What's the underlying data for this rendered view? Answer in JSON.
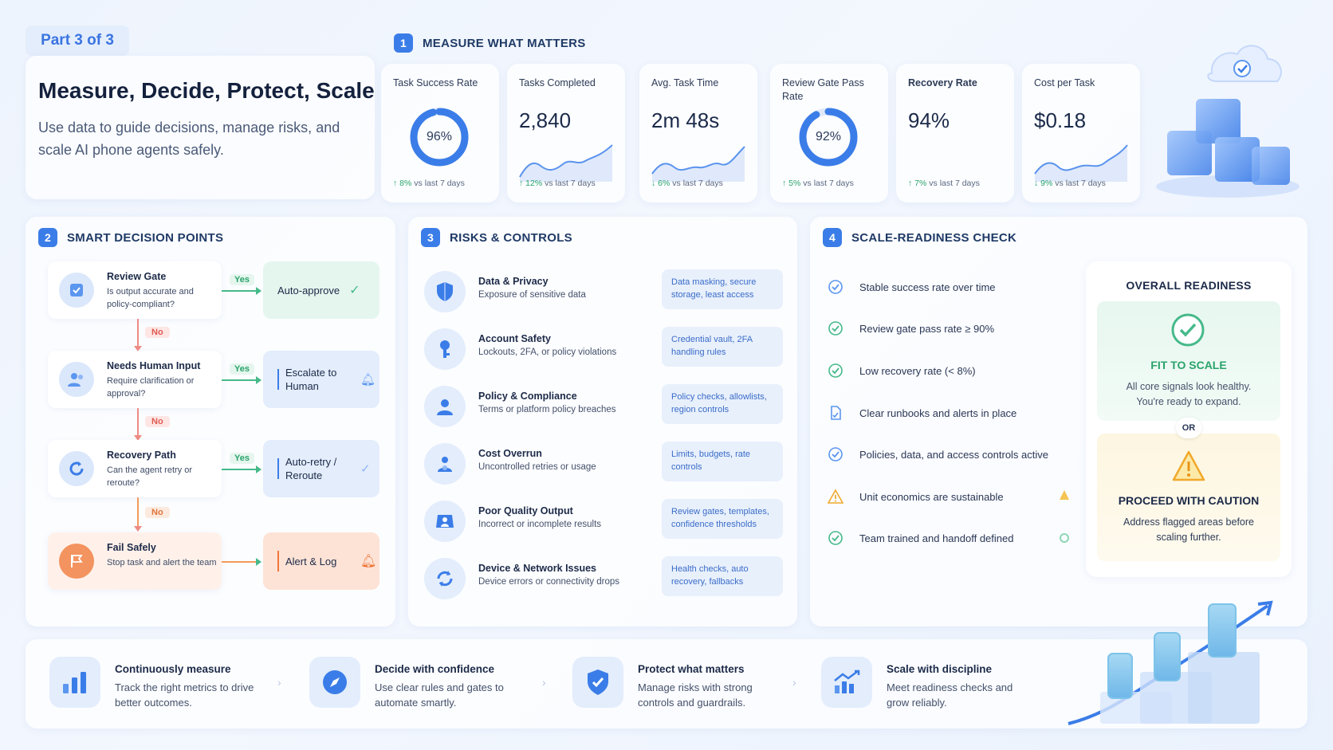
{
  "header": {
    "part": "Part 3 of 3",
    "title": "Measure, Decide, Protect, Scale",
    "subtitle": "Use data to guide decisions, manage risks, and scale AI phone agents safely."
  },
  "measure": {
    "num": "1",
    "title": "MEASURE WHAT MATTERS",
    "metrics": [
      {
        "label": "Task Success Rate",
        "value": "96%",
        "ring": 0.96,
        "arrow": "↑",
        "pct": "8%",
        "suffix": " vs last 7 days"
      },
      {
        "label": "Tasks Completed",
        "value": "2,840",
        "arrow": "↑",
        "pct": "12%",
        "suffix": " vs last 7 days"
      },
      {
        "label": "Avg. Task Time",
        "value": "2m 48s",
        "arrow": "↓",
        "pct": "6%",
        "suffix": " vs last 7 days"
      },
      {
        "label": "Review Gate Pass Rate",
        "value": "92%",
        "ring": 0.92,
        "arrow": "↑",
        "pct": "5%",
        "suffix": " vs last 7 days"
      },
      {
        "label": "Recovery Rate",
        "value": "94%",
        "arrow": "↑",
        "pct": "7%",
        "suffix": " vs last 7 days"
      },
      {
        "label": "Cost per Task",
        "value": "$0.18",
        "arrow": "↓",
        "pct": "9%",
        "suffix": " vs last 7 days"
      }
    ]
  },
  "decisions": {
    "num": "2",
    "title": "SMART DECISION POINTS",
    "yes": "Yes",
    "no": "No",
    "steps": [
      {
        "title": "Review Gate",
        "desc": "Is output accurate and policy-compliant?",
        "outcome": "Auto-approve"
      },
      {
        "title": "Needs Human Input",
        "desc": "Require clarification or approval?",
        "outcome": "Escalate to Human"
      },
      {
        "title": "Recovery Path",
        "desc": "Can the agent retry or reroute?",
        "outcome": "Auto-retry / Reroute"
      },
      {
        "title": "Fail Safely",
        "desc": "Stop task and alert the team",
        "outcome": "Alert & Log"
      }
    ]
  },
  "risks": {
    "num": "3",
    "title": "RISKS & CONTROLS",
    "items": [
      {
        "title": "Data & Privacy",
        "desc": "Exposure of sensitive data",
        "control": "Data masking, secure storage, least access"
      },
      {
        "title": "Account Safety",
        "desc": "Lockouts, 2FA, or policy violations",
        "control": "Credential vault, 2FA handling rules"
      },
      {
        "title": "Policy & Compliance",
        "desc": "Terms or platform policy breaches",
        "control": "Policy checks, allowlists, region controls"
      },
      {
        "title": "Cost Overrun",
        "desc": "Uncontrolled retries or usage",
        "control": "Limits, budgets, rate controls"
      },
      {
        "title": "Poor Quality Output",
        "desc": "Incorrect or incomplete results",
        "control": "Review gates, templates, confidence thresholds"
      },
      {
        "title": "Device & Network Issues",
        "desc": "Device errors or connectivity drops",
        "control": "Health checks, auto recovery, fallbacks"
      }
    ]
  },
  "readiness": {
    "num": "4",
    "title": "SCALE-READINESS CHECK",
    "checks": [
      {
        "text": "Stable success rate over time",
        "status": "ok"
      },
      {
        "text": "Review gate pass rate ≥ 90%",
        "status": "ok"
      },
      {
        "text": "Low recovery rate (< 8%)",
        "status": "ok"
      },
      {
        "text": "Clear runbooks and alerts in place",
        "status": "doc"
      },
      {
        "text": "Policies, data, and access controls active",
        "status": "ok"
      },
      {
        "text": "Unit economics are sustainable",
        "status": "warn"
      },
      {
        "text": "Team trained and handoff defined",
        "status": "ok"
      }
    ],
    "overall_title": "OVERALL READINESS",
    "fit_title": "FIT TO SCALE",
    "fit_desc": "All core signals look healthy. You're ready to expand.",
    "or": "OR",
    "caution_title": "PROCEED WITH CAUTION",
    "caution_desc": "Address flagged areas before scaling further."
  },
  "footer": [
    {
      "title": "Continuously measure",
      "desc": "Track the right metrics to drive better outcomes."
    },
    {
      "title": "Decide with confidence",
      "desc": "Use clear rules and gates to automate smartly."
    },
    {
      "title": "Protect what matters",
      "desc": "Manage risks with strong controls and guardrails."
    },
    {
      "title": "Scale with discipline",
      "desc": "Meet readiness checks and grow reliably."
    }
  ],
  "colors": {
    "accent": "#3b7de8",
    "success": "#2aa36b",
    "danger": "#e05a52",
    "warning": "#f0a92b"
  }
}
